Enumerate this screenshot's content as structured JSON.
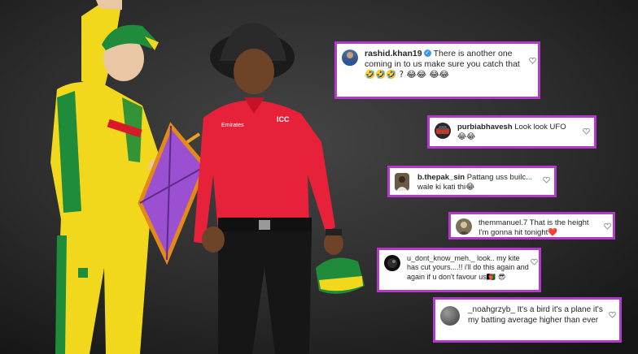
{
  "scene": {
    "colors": {
      "jersey_yellow": "#f2d81c",
      "jersey_green": "#1e8c3a",
      "umpire_red": "#e8213a",
      "kite_purple": "#9b4fd1",
      "card_border": "#b33ac9",
      "heart_red": "#e0245e"
    }
  },
  "comments": [
    {
      "username": "rashid.khan19",
      "verified": true,
      "text": "There is another one coming in to us make sure you catch that",
      "emoji": "🤣🤣🤣 ? 😂😂 😂😂",
      "liked": false
    },
    {
      "username": "purbiabhavesh",
      "verified": false,
      "text": "Look look UFO",
      "emoji": "😂😂",
      "liked": false
    },
    {
      "username": "b.thepak_sin",
      "verified": false,
      "text": "Pattang uss builc... wale ki kati thi",
      "emoji": "😂",
      "liked": false
    },
    {
      "username": "themmanuel.7",
      "verified": false,
      "text": "That is the height I'm gonna hit tonight",
      "emoji": "❤️",
      "liked": false
    },
    {
      "username": "u_dont_know_meh._",
      "verified": false,
      "text": "look.. my kite has cut yours....!! i'll do this again and again if u don't favour us",
      "emoji": "🇦🇫 😎",
      "liked": false
    },
    {
      "username": "_noahgrzyb_",
      "verified": false,
      "text": "It's a bird it's a plane it's my batting average higher than ever",
      "emoji": "",
      "liked": false
    }
  ]
}
